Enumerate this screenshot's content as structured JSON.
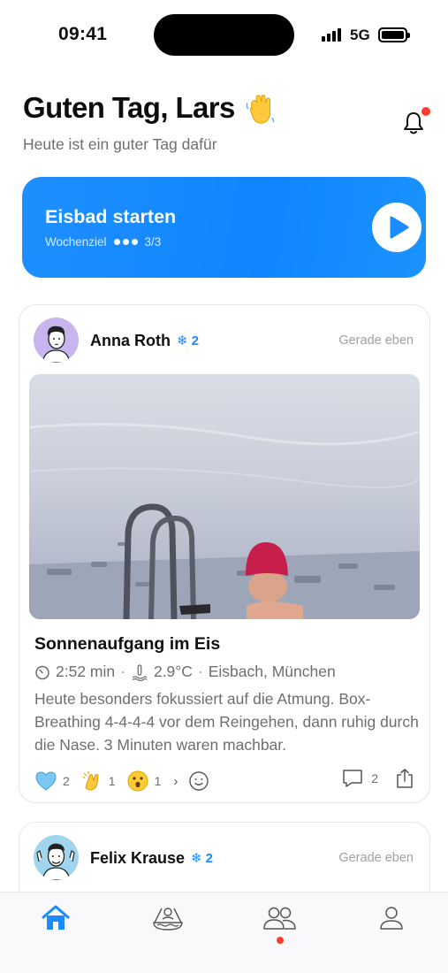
{
  "status_bar": {
    "time": "09:41",
    "network": "5G"
  },
  "header": {
    "greeting": "Guten Tag, Lars",
    "subtitle": "Heute ist ein guter Tag dafür"
  },
  "cta": {
    "title": "Eisbad starten",
    "goal_label": "Wochenziel",
    "goal_progress": "3/3"
  },
  "posts": [
    {
      "author": "Anna Roth",
      "streak": "2",
      "time_ago": "Gerade eben",
      "title": "Sonnenaufgang im Eis",
      "duration": "2:52 min",
      "temperature": "2.9°C",
      "location": "Eisbach, München",
      "text": "Heute besonders fokussiert auf die Atmung. Box-Breathing 4-4-4-4 vor dem Reingehen, dann ruhig durch die Nase. 3 Minuten waren machbar.",
      "reactions": [
        {
          "icon": "blue-heart-icon",
          "count": "2"
        },
        {
          "icon": "clapping-hands-icon",
          "count": "1"
        },
        {
          "icon": "surprised-face-icon",
          "count": "1"
        }
      ],
      "comments": "2"
    },
    {
      "author": "Felix Krause",
      "streak": "2",
      "time_ago": "Gerade eben"
    }
  ],
  "colors": {
    "accent": "#1A8CFF",
    "notification": "#FF3B30"
  }
}
